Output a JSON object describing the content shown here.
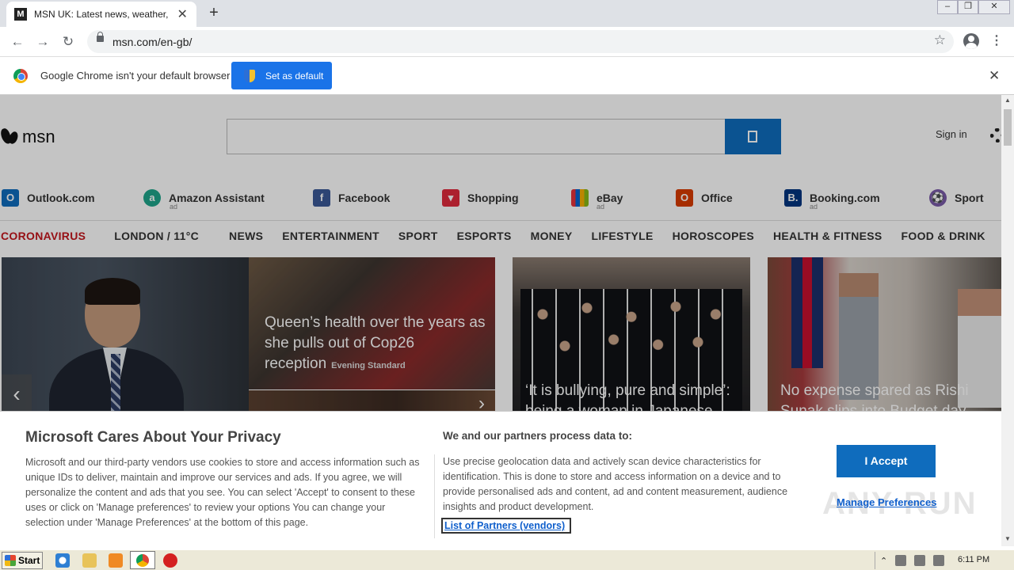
{
  "browser": {
    "tab_title": "MSN UK: Latest news, weather, Hot",
    "tab_favicon": "msn-favicon-icon",
    "new_tab_symbol": "+",
    "url": "msn.com/en-gb/",
    "window_controls": [
      "minimize-icon",
      "restore-icon",
      "close-icon"
    ]
  },
  "infobar": {
    "message": "Google Chrome isn't your default browser",
    "button_label": "Set as default"
  },
  "msn": {
    "logo_text": "msn",
    "search_placeholder": "",
    "sign_in": "Sign in",
    "quick_links": [
      {
        "label": "Outlook.com",
        "icon": "outlook-icon",
        "color": "#0f6cbd",
        "ad": false
      },
      {
        "label": "Amazon Assistant",
        "icon": "amazon-assistant-icon",
        "color": "#1ea58a",
        "ad": true
      },
      {
        "label": "Facebook",
        "icon": "facebook-icon",
        "color": "#3b5998",
        "ad": false
      },
      {
        "label": "Shopping",
        "icon": "shopping-bag-icon",
        "color": "#e02a3c",
        "ad": false
      },
      {
        "label": "eBay",
        "icon": "ebay-icon",
        "color": "#222222",
        "ad": true
      },
      {
        "label": "Office",
        "icon": "office-icon",
        "color": "#d83b01",
        "ad": false
      },
      {
        "label": "Booking.com",
        "icon": "booking-icon",
        "color": "#003580",
        "ad": true
      },
      {
        "label": "Sport",
        "icon": "sport-icon",
        "color": "#7a5aa8",
        "ad": false
      }
    ],
    "ad_label": "ad",
    "nav": {
      "coronavirus": "CORONAVIRUS",
      "weather": "LONDON / 11°C",
      "items": [
        "NEWS",
        "ENTERTAINMENT",
        "SPORT",
        "ESPORTS",
        "MONEY",
        "LIFESTYLE",
        "HOROSCOPES",
        "HEALTH & FITNESS",
        "FOOD & DRINK"
      ]
    },
    "tiles": {
      "tile2_headline": "Queen’s health over the years as she pulls out of Cop26 reception",
      "tile2_source": "Evening Standard",
      "tile3_headline": "‘It is bullying, pure and simple’: being a woman in Japanese",
      "tile4_headline": "No expense spared as Rishi Sunak slips into Budget day"
    }
  },
  "privacy": {
    "title": "Microsoft Cares About Your Privacy",
    "body": "Microsoft and our third-party vendors use cookies to store and access information such as unique IDs to deliver, maintain and improve our services and ads. If you agree, we will personalize the content and ads that you see. You can select 'Accept' to consent to these uses or click on 'Manage preferences' to review your options You can change your selection under 'Manage Preferences' at the bottom of this page.",
    "purposes_title": "We and our partners process data to:",
    "purposes_body": "Use precise geolocation data and actively scan device characteristics for identification. This is done to store and access information on a device and to provide personalised ads and content, ad and content measurement, audience insights and product development.",
    "partners_link": "List of Partners (vendors)",
    "accept_label": "I Accept",
    "manage_label": "Manage Preferences",
    "watermark": "ANY RUN"
  },
  "taskbar": {
    "start_label": "Start",
    "clock": "6:11 PM"
  }
}
